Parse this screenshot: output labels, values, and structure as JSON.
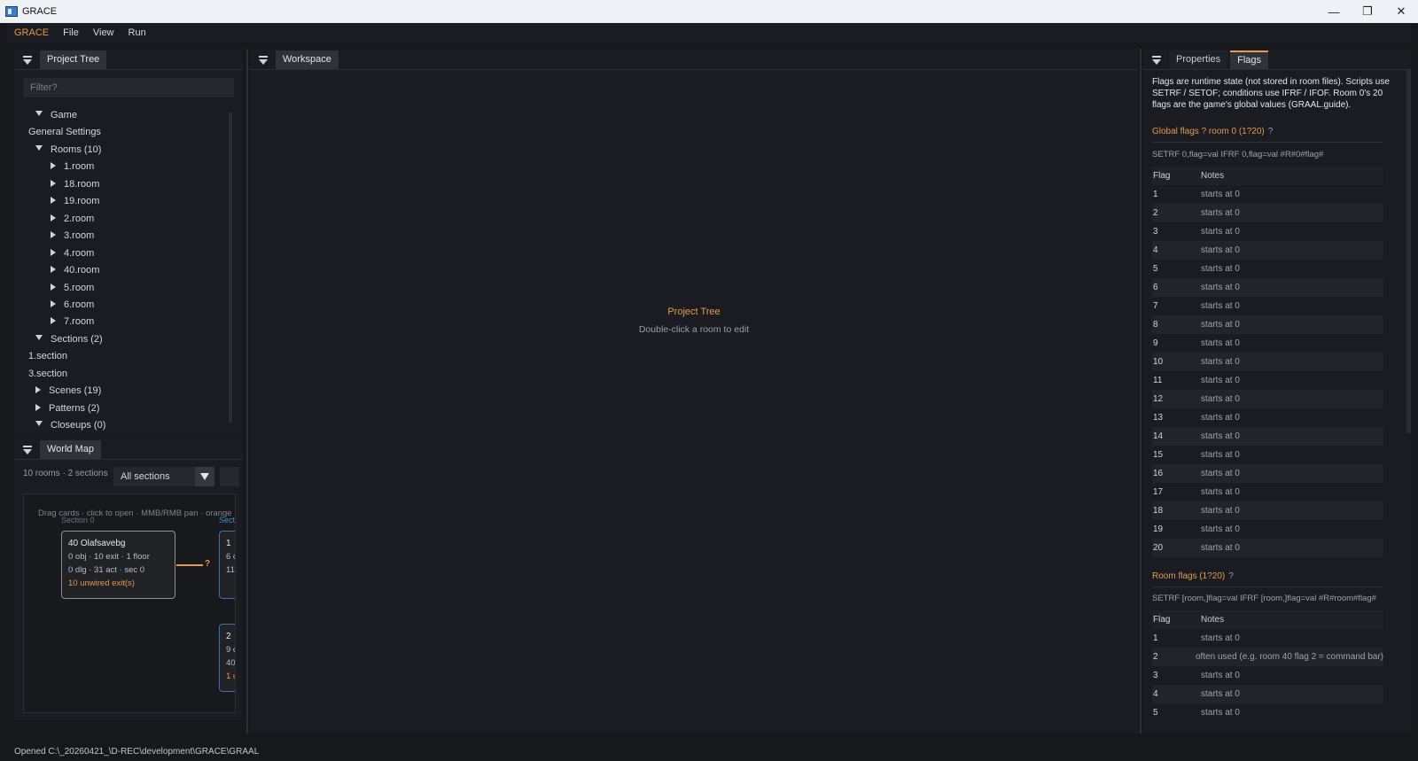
{
  "window": {
    "title": "GRACE",
    "minimize": "—",
    "restore": "❐",
    "close": "✕"
  },
  "menu": {
    "brand": "GRACE",
    "items": [
      "File",
      "View",
      "Run"
    ]
  },
  "project_tree": {
    "tab": "Project Tree",
    "filter_placeholder": "Filter?",
    "rows": [
      {
        "label": "Game",
        "level": 0,
        "caret": "down"
      },
      {
        "label": "General Settings",
        "level": 1,
        "caret": "none"
      },
      {
        "label": "Rooms (10)",
        "level": 0,
        "caret": "down"
      },
      {
        "label": "1.room",
        "level": 2,
        "caret": "right"
      },
      {
        "label": "18.room",
        "level": 2,
        "caret": "right"
      },
      {
        "label": "19.room",
        "level": 2,
        "caret": "right"
      },
      {
        "label": "2.room",
        "level": 2,
        "caret": "right"
      },
      {
        "label": "3.room",
        "level": 2,
        "caret": "right"
      },
      {
        "label": "4.room",
        "level": 2,
        "caret": "right"
      },
      {
        "label": "40.room",
        "level": 2,
        "caret": "right"
      },
      {
        "label": "5.room",
        "level": 2,
        "caret": "right"
      },
      {
        "label": "6.room",
        "level": 2,
        "caret": "right"
      },
      {
        "label": "7.room",
        "level": 2,
        "caret": "right"
      },
      {
        "label": "Sections (2)",
        "level": 0,
        "caret": "down"
      },
      {
        "label": "1.section",
        "level": 1,
        "caret": "none"
      },
      {
        "label": "3.section",
        "level": 1,
        "caret": "none"
      },
      {
        "label": "Scenes (19)",
        "level": 0,
        "caret": "right"
      },
      {
        "label": "Patterns (2)",
        "level": 0,
        "caret": "right"
      },
      {
        "label": "Closeups (0)",
        "level": 0,
        "caret": "down"
      }
    ]
  },
  "world_map": {
    "tab": "World Map",
    "info": "10 rooms · 2 sections",
    "select": "All sections",
    "hint": "Drag cards · click to open · MMB/RMB pan · orange",
    "section_a": "Section 0",
    "section_b": "Secti",
    "card_main": {
      "title": "40  Olafsavebg",
      "line1": "0 obj · 10 exit · 1 floor",
      "line2": "0 dlg · 31 act · sec 0",
      "warn": "10 unwired exit(s)"
    },
    "card_b": {
      "title": "1",
      "line1": "6 c",
      "line2": "11"
    },
    "card_c": {
      "title": "2",
      "line1": "9 c",
      "line2": "40",
      "warn": "1 u"
    },
    "link_label": "?"
  },
  "workspace": {
    "tab": "Workspace",
    "title": "Project Tree",
    "hint": "Double-click a room to edit"
  },
  "right_panel": {
    "tabs": [
      "Properties",
      "Flags"
    ],
    "description": "Flags are runtime state (not stored in room files). Scripts use SETRF / SETOF; conditions use IFRF / IFOF. Room 0's 20 flags are the game's global values (GRAAL.guide).",
    "global": {
      "title": "Global flags ? room 0 (1?20)",
      "help": "?",
      "syntax": "SETRF 0,flag=val   IFRF 0,flag=val   #R#0#flag#",
      "head": [
        "Flag",
        "Notes"
      ],
      "rows": [
        [
          "1",
          "starts at 0"
        ],
        [
          "2",
          "starts at 0"
        ],
        [
          "3",
          "starts at 0"
        ],
        [
          "4",
          "starts at 0"
        ],
        [
          "5",
          "starts at 0"
        ],
        [
          "6",
          "starts at 0"
        ],
        [
          "7",
          "starts at 0"
        ],
        [
          "8",
          "starts at 0"
        ],
        [
          "9",
          "starts at 0"
        ],
        [
          "10",
          "starts at 0"
        ],
        [
          "11",
          "starts at 0"
        ],
        [
          "12",
          "starts at 0"
        ],
        [
          "13",
          "starts at 0"
        ],
        [
          "14",
          "starts at 0"
        ],
        [
          "15",
          "starts at 0"
        ],
        [
          "16",
          "starts at 0"
        ],
        [
          "17",
          "starts at 0"
        ],
        [
          "18",
          "starts at 0"
        ],
        [
          "19",
          "starts at 0"
        ],
        [
          "20",
          "starts at 0"
        ]
      ]
    },
    "room": {
      "title": "Room flags (1?20)",
      "help": "?",
      "syntax": "SETRF [room,]flag=val   IFRF [room,]flag=val   #R#room#flag#",
      "head": [
        "Flag",
        "Notes"
      ],
      "rows": [
        [
          "1",
          "starts at 0"
        ],
        [
          "2",
          "often used (e.g. room 40 flag 2 = command bar)"
        ],
        [
          "3",
          "starts at 0"
        ],
        [
          "4",
          "starts at 0"
        ],
        [
          "5",
          "starts at 0"
        ]
      ]
    }
  },
  "status": "Opened  C:\\_20260421_\\D-REC\\development\\GRACE\\GRAAL",
  "colors": {
    "accent": "#e39a4e",
    "blue": "#3e6fae",
    "background": "#17181c"
  }
}
